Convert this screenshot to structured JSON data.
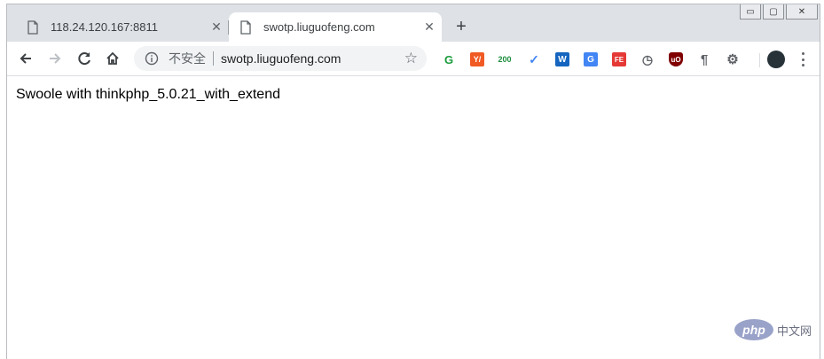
{
  "tabs": [
    {
      "title": "118.24.120.167:8811",
      "active": false
    },
    {
      "title": "swotp.liuguofeng.com",
      "active": true
    }
  ],
  "window_controls": [
    "minimize-icon",
    "restore-icon",
    "close-icon"
  ],
  "toolbar": {
    "back": "arrow-left-icon",
    "forward": "arrow-right-icon",
    "reload": "reload-icon",
    "home": "home-icon"
  },
  "omnibox": {
    "security_label": "不安全",
    "url": "swotp.liuguofeng.com",
    "bookmark": "star-icon"
  },
  "extensions": [
    {
      "name": "grammarly-icon",
      "text": "G",
      "color": "#1a9c3c"
    },
    {
      "name": "translate-ext-icon",
      "text": "Y",
      "color": "#f15a24"
    },
    {
      "name": "status-200-icon",
      "text": "200",
      "color": "#1e8e3e"
    },
    {
      "name": "checkmark-ext-icon",
      "text": "✓",
      "color": "#4285f4"
    },
    {
      "name": "word-ext-icon",
      "text": "W",
      "color": "#1565c0"
    },
    {
      "name": "google-translate-icon",
      "text": "G",
      "color": "#4285f4"
    },
    {
      "name": "fe-helper-icon",
      "text": "FE",
      "color": "#e53935"
    },
    {
      "name": "timer-ext-icon",
      "text": "◷",
      "color": "#5f6368"
    },
    {
      "name": "ublock-icon",
      "text": "uO",
      "color": "#800000"
    },
    {
      "name": "paragraph-ext-icon",
      "text": "¶",
      "color": "#5f6368"
    },
    {
      "name": "gear-ext-icon",
      "text": "⚙",
      "color": "#5f6368"
    },
    {
      "name": "profile-avatar-icon",
      "text": "",
      "color": "#263238"
    }
  ],
  "page": {
    "text": "Swoole with thinkphp_5.0.21_with_extend"
  },
  "watermark": {
    "logo": "php",
    "text": "中文网"
  }
}
